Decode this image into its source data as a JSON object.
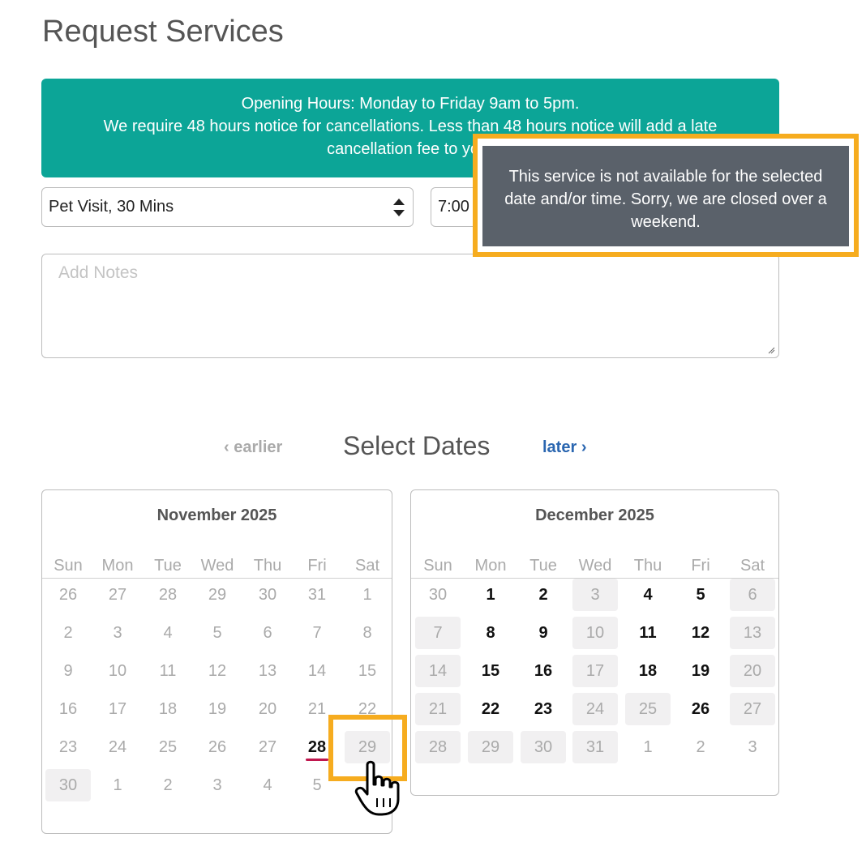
{
  "header": {
    "title": "Request Services"
  },
  "banner": {
    "line1": "Opening Hours: Monday to Friday 9am to 5pm.",
    "line2": "We require 48 hours notice for cancellations. Less than 48 hours notice will add a late",
    "line3": "cancellation fee to your"
  },
  "form": {
    "service_value": "Pet Visit, 30 Mins",
    "time_value": "7:00",
    "notes_placeholder": "Add Notes"
  },
  "tooltip": {
    "line1": "This service is not available for the selected",
    "line2": "date and/or time. Sorry, we are closed over a",
    "line3": "weekend."
  },
  "calendar_nav": {
    "earlier_label": "earlier",
    "later_label": "later",
    "title": "Select Dates"
  },
  "weekday_labels": [
    "Sun",
    "Mon",
    "Tue",
    "Wed",
    "Thu",
    "Fri",
    "Sat"
  ],
  "months": [
    {
      "name": "November 2025",
      "weeks": [
        [
          {
            "d": "26",
            "s": "muted"
          },
          {
            "d": "27",
            "s": "muted"
          },
          {
            "d": "28",
            "s": "muted"
          },
          {
            "d": "29",
            "s": "muted"
          },
          {
            "d": "30",
            "s": "muted"
          },
          {
            "d": "31",
            "s": "muted"
          },
          {
            "d": "1",
            "s": "muted"
          }
        ],
        [
          {
            "d": "2",
            "s": "muted"
          },
          {
            "d": "3",
            "s": "muted"
          },
          {
            "d": "4",
            "s": "muted"
          },
          {
            "d": "5",
            "s": "muted"
          },
          {
            "d": "6",
            "s": "muted"
          },
          {
            "d": "7",
            "s": "muted"
          },
          {
            "d": "8",
            "s": "muted"
          }
        ],
        [
          {
            "d": "9",
            "s": "muted"
          },
          {
            "d": "10",
            "s": "muted"
          },
          {
            "d": "11",
            "s": "muted"
          },
          {
            "d": "12",
            "s": "muted"
          },
          {
            "d": "13",
            "s": "muted"
          },
          {
            "d": "14",
            "s": "muted"
          },
          {
            "d": "15",
            "s": "muted"
          }
        ],
        [
          {
            "d": "16",
            "s": "muted"
          },
          {
            "d": "17",
            "s": "muted"
          },
          {
            "d": "18",
            "s": "muted"
          },
          {
            "d": "19",
            "s": "muted"
          },
          {
            "d": "20",
            "s": "muted"
          },
          {
            "d": "21",
            "s": "muted"
          },
          {
            "d": "22",
            "s": "muted"
          }
        ],
        [
          {
            "d": "23",
            "s": "muted"
          },
          {
            "d": "24",
            "s": "muted"
          },
          {
            "d": "25",
            "s": "muted"
          },
          {
            "d": "26",
            "s": "muted"
          },
          {
            "d": "27",
            "s": "muted"
          },
          {
            "d": "28",
            "s": "today"
          },
          {
            "d": "29",
            "s": "closed"
          }
        ],
        [
          {
            "d": "30",
            "s": "closed"
          },
          {
            "d": "1",
            "s": "muted"
          },
          {
            "d": "2",
            "s": "muted"
          },
          {
            "d": "3",
            "s": "muted"
          },
          {
            "d": "4",
            "s": "muted"
          },
          {
            "d": "5",
            "s": "muted"
          },
          {
            "d": "",
            "s": "muted"
          }
        ]
      ]
    },
    {
      "name": "December 2025",
      "weeks": [
        [
          {
            "d": "30",
            "s": "muted"
          },
          {
            "d": "1",
            "s": "avail"
          },
          {
            "d": "2",
            "s": "avail"
          },
          {
            "d": "3",
            "s": "closed"
          },
          {
            "d": "4",
            "s": "avail"
          },
          {
            "d": "5",
            "s": "avail"
          },
          {
            "d": "6",
            "s": "closed"
          }
        ],
        [
          {
            "d": "7",
            "s": "closed"
          },
          {
            "d": "8",
            "s": "avail"
          },
          {
            "d": "9",
            "s": "avail"
          },
          {
            "d": "10",
            "s": "closed"
          },
          {
            "d": "11",
            "s": "avail"
          },
          {
            "d": "12",
            "s": "avail"
          },
          {
            "d": "13",
            "s": "closed"
          }
        ],
        [
          {
            "d": "14",
            "s": "closed"
          },
          {
            "d": "15",
            "s": "avail"
          },
          {
            "d": "16",
            "s": "avail"
          },
          {
            "d": "17",
            "s": "closed"
          },
          {
            "d": "18",
            "s": "avail"
          },
          {
            "d": "19",
            "s": "avail"
          },
          {
            "d": "20",
            "s": "closed"
          }
        ],
        [
          {
            "d": "21",
            "s": "closed"
          },
          {
            "d": "22",
            "s": "avail"
          },
          {
            "d": "23",
            "s": "avail"
          },
          {
            "d": "24",
            "s": "closed"
          },
          {
            "d": "25",
            "s": "closed"
          },
          {
            "d": "26",
            "s": "avail"
          },
          {
            "d": "27",
            "s": "closed"
          }
        ],
        [
          {
            "d": "28",
            "s": "closed"
          },
          {
            "d": "29",
            "s": "closed"
          },
          {
            "d": "30",
            "s": "closed"
          },
          {
            "d": "31",
            "s": "closed"
          },
          {
            "d": "1",
            "s": "muted"
          },
          {
            "d": "2",
            "s": "muted"
          },
          {
            "d": "3",
            "s": "muted"
          }
        ]
      ]
    }
  ],
  "colors": {
    "banner_bg": "#0ca597",
    "tooltip_bg": "#5a616a",
    "highlight": "#f6ac1f",
    "link": "#2a66b0",
    "today_underline": "#c0174e"
  }
}
